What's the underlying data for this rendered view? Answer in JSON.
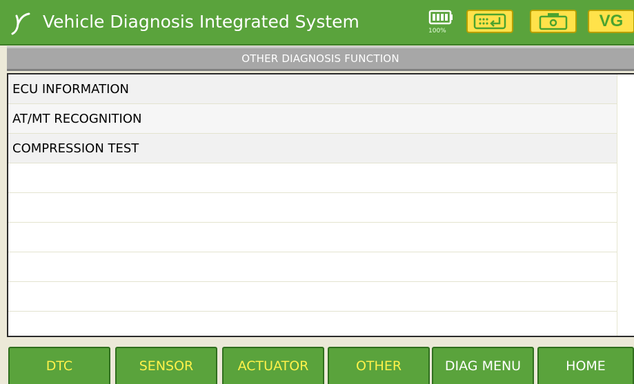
{
  "header": {
    "title": "Vehicle Diagnosis Integrated System",
    "battery_percent": "100%",
    "vg_label": "VG",
    "icons": [
      "logo-icon",
      "battery-icon",
      "keyboard-icon",
      "camera-icon"
    ]
  },
  "section": {
    "title": "OTHER DIAGNOSIS FUNCTION"
  },
  "list": {
    "items": [
      {
        "label": "ECU INFORMATION"
      },
      {
        "label": "AT/MT RECOGNITION"
      },
      {
        "label": "COMPRESSION TEST"
      }
    ]
  },
  "tabs": [
    {
      "label": "DTC",
      "color": "#fff24a"
    },
    {
      "label": "SENSOR",
      "color": "#fff24a"
    },
    {
      "label": "ACTUATOR",
      "color": "#fff24a"
    },
    {
      "label": "OTHER",
      "color": "#fff24a"
    },
    {
      "label": "DIAG MENU",
      "color": "#ffffff"
    },
    {
      "label": "HOME",
      "color": "#ffffff"
    }
  ],
  "colors": {
    "titlebar_green": "#5aa33c",
    "button_yellow": "#ffe24a",
    "section_gray": "#a7a7a7"
  }
}
